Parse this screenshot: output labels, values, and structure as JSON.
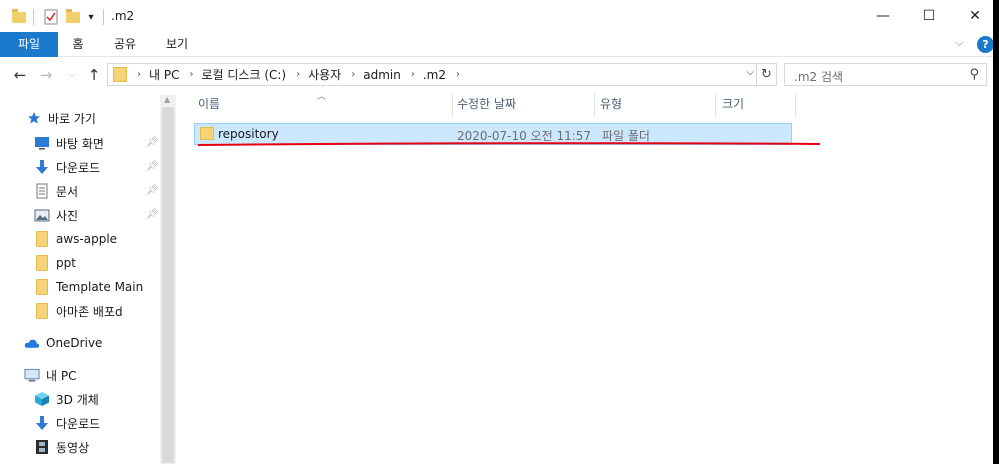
{
  "window": {
    "title": ".m2",
    "controls": {
      "minimize": "—",
      "maximize": "☐",
      "close": "✕"
    }
  },
  "ribbon": {
    "tabs": [
      "파일",
      "홈",
      "공유",
      "보기"
    ],
    "expand_icon": "chevron-down-icon",
    "help_label": "?"
  },
  "address": {
    "crumbs": [
      "내 PC",
      "로컬 디스크 (C:)",
      "사용자",
      "admin",
      ".m2"
    ],
    "separator": "›"
  },
  "search": {
    "placeholder": ".m2 검색"
  },
  "sidebar": {
    "quick_access": {
      "label": "바로 가기",
      "icon": "star-icon",
      "icon_color": "#2b7bd3"
    },
    "quick_items": [
      {
        "label": "바탕 화면",
        "icon": "desktop-icon",
        "pinned": true
      },
      {
        "label": "다운로드",
        "icon": "download-icon",
        "pinned": true
      },
      {
        "label": "문서",
        "icon": "document-icon",
        "pinned": true
      },
      {
        "label": "사진",
        "icon": "picture-icon",
        "pinned": true
      },
      {
        "label": "aws-apple",
        "icon": "folder-icon",
        "pinned": false
      },
      {
        "label": "ppt",
        "icon": "folder-icon",
        "pinned": false
      },
      {
        "label": "Template Main",
        "icon": "folder-icon",
        "pinned": false
      },
      {
        "label": "아마존 배포d",
        "icon": "folder-icon",
        "pinned": false
      }
    ],
    "onedrive": {
      "label": "OneDrive",
      "icon": "cloud-icon",
      "icon_color": "#1f7ae0"
    },
    "this_pc": {
      "label": "내 PC",
      "icon": "computer-icon"
    },
    "pc_items": [
      {
        "label": "3D 개체",
        "icon": "cube-icon"
      },
      {
        "label": "다운로드",
        "icon": "download-icon"
      },
      {
        "label": "동영상",
        "icon": "film-icon"
      }
    ]
  },
  "columns": {
    "name": "이름",
    "date": "수정한 날짜",
    "type": "유형",
    "size": "크기"
  },
  "files": [
    {
      "name": "repository",
      "date": "2020-07-10 오전 11:57",
      "type": "파일 폴더",
      "size": "",
      "selected": true
    }
  ],
  "colors": {
    "accent": "#1979ca",
    "selection_bg": "#cce8ff",
    "selection_border": "#99d1ff",
    "annotation_line": "#e60012"
  }
}
